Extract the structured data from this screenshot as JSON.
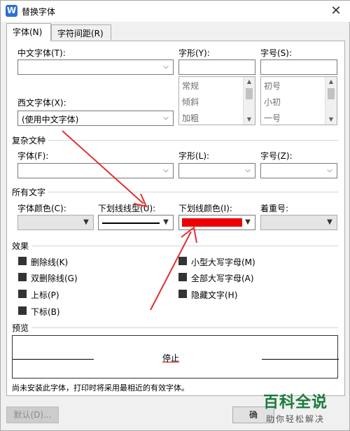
{
  "window": {
    "title": "替换字体",
    "app_icon": "W"
  },
  "tabs": [
    {
      "label": "字体(N)",
      "active": true
    },
    {
      "label": "字符间距(R)",
      "active": false
    }
  ],
  "font_section": {
    "chinese_font_label": "中文字体(T):",
    "chinese_font_value": "",
    "western_font_label": "西文字体(X):",
    "western_font_value": "(使用中文字体)",
    "style_label": "字形(Y):",
    "style_value": "",
    "style_options": [
      "常规",
      "倾斜",
      "加粗"
    ],
    "size_label": "字号(S):",
    "size_value": "",
    "size_options": [
      "初号",
      "小初",
      "一号"
    ]
  },
  "complex_section": {
    "header": "复杂文种",
    "font_label": "字体(F):",
    "style_label": "字形(L):",
    "size_label": "字号(Z):"
  },
  "all_text_section": {
    "header": "所有文字",
    "font_color_label": "字体颜色(C):",
    "underline_type_label": "下划线线型(U):",
    "underline_color_label": "下划线颜色(I):",
    "emphasis_label": "着重号:",
    "underline_color": "#ee0000"
  },
  "effects": {
    "header": "效果",
    "items": [
      {
        "label": "删除线(K)"
      },
      {
        "label": "双删除线(G)"
      },
      {
        "label": "上标(P)"
      },
      {
        "label": "下标(B)"
      },
      {
        "label": "小型大写字母(M)"
      },
      {
        "label": "全部大写字母(A)"
      },
      {
        "label": "隐藏文字(H)"
      }
    ]
  },
  "preview": {
    "header": "预览",
    "sample_text": "停止"
  },
  "note": "尚未安装此字体，打印时将采用最相近的有效字体。",
  "buttons": {
    "default_label": "默认(D)...",
    "ok_label": "确"
  },
  "watermark": {
    "title": "百科全说",
    "subtitle": "助你轻松解决"
  },
  "annotation_color": "#e03030"
}
